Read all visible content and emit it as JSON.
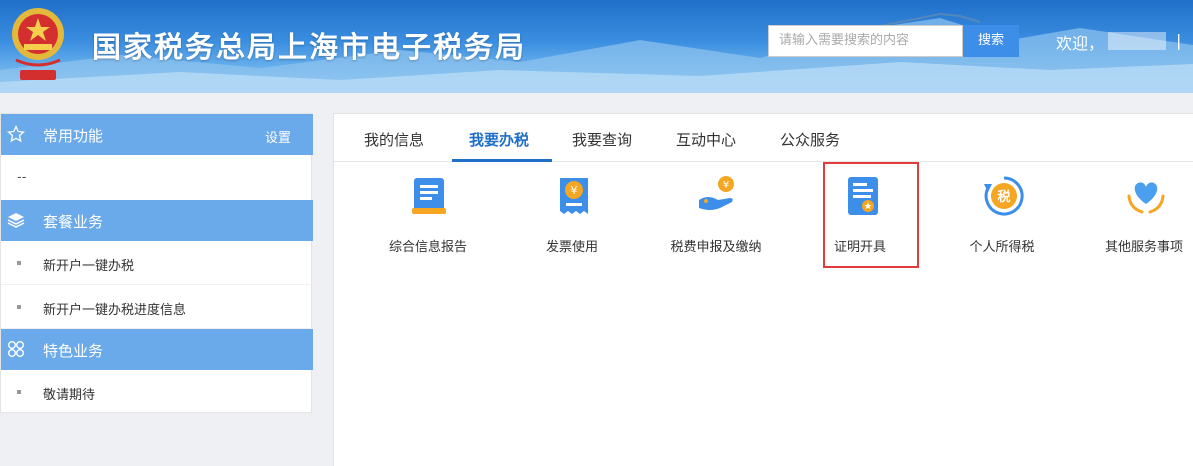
{
  "header": {
    "title": "国家税务总局上海市电子税务局",
    "search_placeholder": "请输入需要搜索的内容",
    "search_button": "搜索",
    "welcome": "欢迎，",
    "separator": "|"
  },
  "sidebar": {
    "common": {
      "title": "常用功能",
      "setting": "设置",
      "empty": "--"
    },
    "package": {
      "title": "套餐业务",
      "items": [
        {
          "label": "新开户一键办税"
        },
        {
          "label": "新开户一键办税进度信息"
        }
      ]
    },
    "special": {
      "title": "特色业务",
      "items": [
        {
          "label": "敬请期待"
        }
      ]
    }
  },
  "tabs": [
    {
      "label": "我的信息"
    },
    {
      "label": "我要办税",
      "active": true
    },
    {
      "label": "我要查询"
    },
    {
      "label": "互动中心"
    },
    {
      "label": "公众服务"
    }
  ],
  "services": [
    {
      "label": "综合信息报告",
      "icon": "report-icon"
    },
    {
      "label": "发票使用",
      "icon": "invoice-icon"
    },
    {
      "label": "税费申报及缴纳",
      "icon": "tax-payment-icon"
    },
    {
      "label": "证明开具",
      "icon": "certificate-icon",
      "highlighted": true
    },
    {
      "label": "个人所得税",
      "icon": "personal-tax-icon"
    },
    {
      "label": "其他服务事项",
      "icon": "other-services-icon"
    }
  ],
  "colors": {
    "primary": "#1f6fc9",
    "sidebar_header": "#6aa9ea",
    "icon_blue": "#3d8ee8",
    "icon_orange": "#f5a623",
    "highlight": "#e23b3b"
  }
}
